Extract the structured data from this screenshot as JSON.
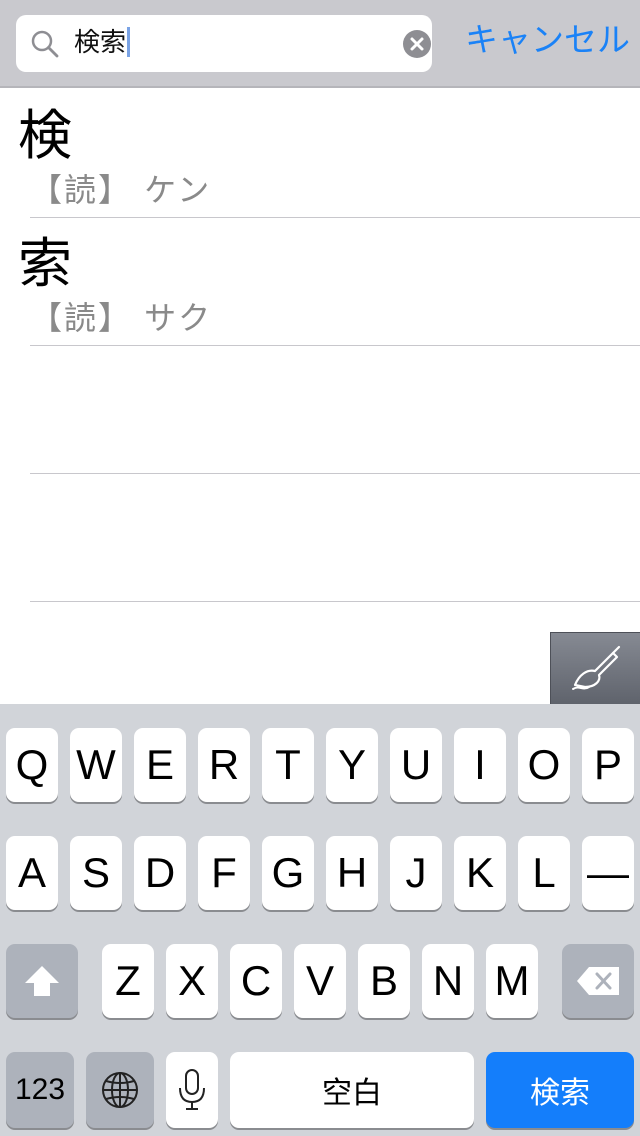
{
  "search": {
    "query": "検索",
    "cancel_label": "キャンセル"
  },
  "results": [
    {
      "kanji": "検",
      "reading": "【読】 ケン"
    },
    {
      "kanji": "索",
      "reading": "【読】 サク"
    },
    {
      "kanji": "",
      "reading": ""
    },
    {
      "kanji": "",
      "reading": ""
    }
  ],
  "keyboard": {
    "row1": [
      "Q",
      "W",
      "E",
      "R",
      "T",
      "Y",
      "U",
      "I",
      "O",
      "P"
    ],
    "row2": [
      "A",
      "S",
      "D",
      "F",
      "G",
      "H",
      "J",
      "K",
      "L",
      "—"
    ],
    "row3": [
      "Z",
      "X",
      "C",
      "V",
      "B",
      "N",
      "M"
    ],
    "numbers_label": "123",
    "space_label": "空白",
    "return_label": "検索"
  },
  "colors": {
    "accent": "#1a82f7",
    "return_key": "#147efb",
    "keyboard_bg": "#d1d4d9"
  },
  "icons": {
    "search": "magnifier-icon",
    "clear": "clear-x-circle-icon",
    "handwriting": "pen-hand-icon",
    "shift": "shift-arrow-icon",
    "delete": "backspace-icon",
    "globe": "globe-icon",
    "mic": "microphone-icon"
  }
}
